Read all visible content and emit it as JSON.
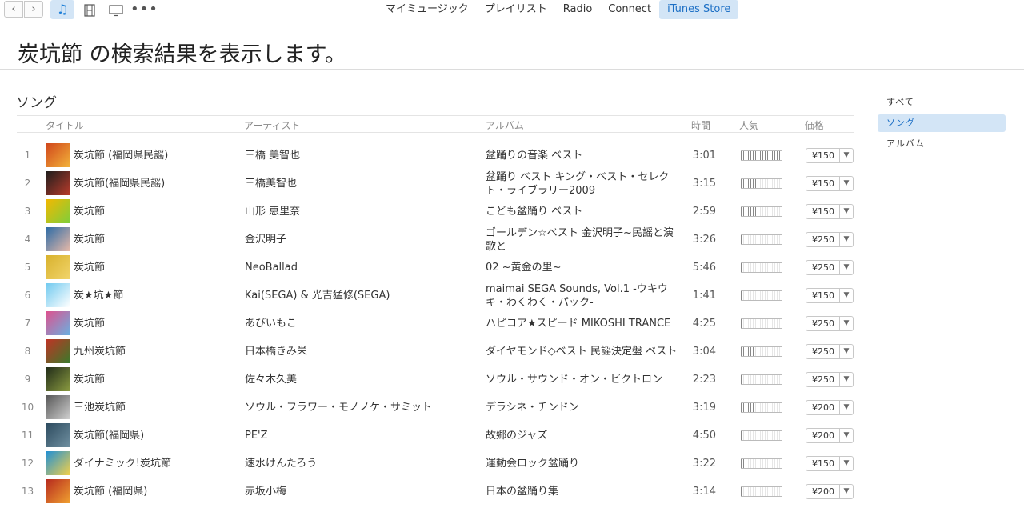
{
  "toolbar": {
    "back_icon": "chevron-left-icon",
    "forward_icon": "chevron-right-icon",
    "media": [
      "music-note-icon",
      "film-icon",
      "tv-icon",
      "more-dots-icon"
    ],
    "tabs": [
      {
        "label": "マイミュージック",
        "active": false
      },
      {
        "label": "プレイリスト",
        "active": false
      },
      {
        "label": "Radio",
        "active": false
      },
      {
        "label": "Connect",
        "active": false
      },
      {
        "label": "iTunes Store",
        "active": true
      }
    ]
  },
  "heading": "炭坑節 の検索結果を表示します。",
  "section_title": "ソング",
  "columns": {
    "title": "タイトル",
    "artist": "アーティスト",
    "album": "アルバム",
    "time": "時間",
    "popularity": "人気",
    "price": "価格"
  },
  "songs": [
    {
      "num": "1",
      "title": "炭坑節 (福岡県民謡)",
      "artist": "三橋 美智也",
      "album": "盆踊りの音楽 ベスト",
      "time": "3:01",
      "popularity": 1.0,
      "price": "¥150",
      "art_colors": [
        "#d0451b",
        "#f2b23a"
      ]
    },
    {
      "num": "2",
      "title": "炭坑節(福岡県民謡)",
      "artist": "三橋美智也",
      "album": "盆踊り ベスト キング・ベスト・セレクト・ライブラリー2009",
      "time": "3:15",
      "popularity": 0.45,
      "price": "¥150",
      "art_colors": [
        "#1d1d1d",
        "#b83b2b"
      ]
    },
    {
      "num": "3",
      "title": "炭坑節",
      "artist": "山形 恵里奈",
      "album": "こども盆踊り ベスト",
      "time": "2:59",
      "popularity": 0.45,
      "price": "¥150",
      "art_colors": [
        "#f5b700",
        "#7fcf3a"
      ]
    },
    {
      "num": "4",
      "title": "炭坑節",
      "artist": "金沢明子",
      "album": "ゴールデン☆ベスト 金沢明子~民謡と演歌と",
      "time": "3:26",
      "popularity": 0.06,
      "price": "¥250",
      "art_colors": [
        "#2a6aa6",
        "#e6b9a8"
      ]
    },
    {
      "num": "5",
      "title": "炭坑節",
      "artist": "NeoBallad",
      "album": "02 ~黄金の里~",
      "time": "5:46",
      "popularity": 0.06,
      "price": "¥250",
      "art_colors": [
        "#d8b12c",
        "#f1d46a"
      ]
    },
    {
      "num": "6",
      "title": "炭★坑★節",
      "artist": "Kai(SEGA) & 光吉猛修(SEGA)",
      "album": "maimai SEGA Sounds, Vol.1 -ウキウキ・わくわく・パック-",
      "time": "1:41",
      "popularity": 0.06,
      "price": "¥150",
      "art_colors": [
        "#6fc9ef",
        "#ffffff"
      ]
    },
    {
      "num": "7",
      "title": "炭坑節",
      "artist": "あびいもこ",
      "album": "ハピコア★スピード MIKOSHI TRANCE",
      "time": "4:25",
      "popularity": 0.06,
      "price": "¥250",
      "art_colors": [
        "#e0508d",
        "#6ab0e0"
      ]
    },
    {
      "num": "8",
      "title": "九州炭坑節",
      "artist": "日本橋きみ栄",
      "album": "ダイヤモンド◇ベスト 民謡決定盤 ベスト",
      "time": "3:04",
      "popularity": 0.3,
      "price": "¥250",
      "art_colors": [
        "#c23225",
        "#3a7a2a"
      ]
    },
    {
      "num": "9",
      "title": "炭坑節",
      "artist": "佐々木久美",
      "album": "ソウル・サウンド・オン・ビクトロン",
      "time": "2:23",
      "popularity": 0.06,
      "price": "¥250",
      "art_colors": [
        "#1f2a18",
        "#8a9a40"
      ]
    },
    {
      "num": "10",
      "title": "三池炭坑節",
      "artist": "ソウル・フラワー・モノノケ・サミット",
      "album": "デラシネ・チンドン",
      "time": "3:19",
      "popularity": 0.3,
      "price": "¥200",
      "art_colors": [
        "#555555",
        "#cfcfcf"
      ]
    },
    {
      "num": "11",
      "title": "炭坑節(福岡県)",
      "artist": "PE'Z",
      "album": "故郷のジャズ",
      "time": "4:50",
      "popularity": 0.06,
      "price": "¥200",
      "art_colors": [
        "#2c4a5e",
        "#6f8fa0"
      ]
    },
    {
      "num": "12",
      "title": "ダイナミック!炭坑節",
      "artist": "速水けんたろう",
      "album": "運動会ロック盆踊り",
      "time": "3:22",
      "popularity": 0.15,
      "price": "¥150",
      "art_colors": [
        "#1e8fd6",
        "#f2d04a"
      ]
    },
    {
      "num": "13",
      "title": "炭坑節 (福岡県)",
      "artist": "赤坂小梅",
      "album": "日本の盆踊り集",
      "time": "3:14",
      "popularity": 0.06,
      "price": "¥200",
      "art_colors": [
        "#b5281e",
        "#f0a030"
      ]
    }
  ],
  "filters": [
    {
      "label": "すべて",
      "active": false
    },
    {
      "label": "ソング",
      "active": true
    },
    {
      "label": "アルバム",
      "active": false
    }
  ],
  "colors": {
    "accent": "#1c6fc5",
    "highlight": "#d3e5f6"
  }
}
